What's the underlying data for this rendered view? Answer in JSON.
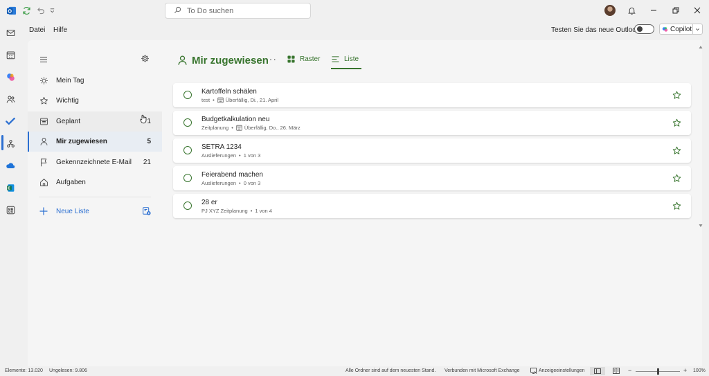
{
  "titlebar": {
    "search_placeholder": "To Do suchen"
  },
  "menubar": {
    "items": [
      "Datei",
      "Hilfe"
    ],
    "outlook_toggle_label": "Testen Sie das neue Outlook",
    "copilot_label": "Copilot"
  },
  "sidebar": {
    "items": [
      {
        "label": "Mein Tag",
        "count": "",
        "icon": "sun-icon"
      },
      {
        "label": "Wichtig",
        "count": "",
        "icon": "star-icon"
      },
      {
        "label": "Geplant",
        "count": "1",
        "icon": "calendar-icon"
      },
      {
        "label": "Mir zugewiesen",
        "count": "5",
        "icon": "person-icon"
      },
      {
        "label": "Gekennzeichnete E-Mail",
        "count": "21",
        "icon": "flag-icon"
      },
      {
        "label": "Aufgaben",
        "count": "",
        "icon": "home-icon"
      }
    ],
    "new_list_label": "Neue Liste"
  },
  "main": {
    "title": "Mir zugewiesen",
    "more": "···",
    "view_grid": "Raster",
    "view_list": "Liste",
    "tasks": [
      {
        "title": "Kartoffeln schälen",
        "list": "test",
        "detail": "Überfällig, Di., 21. April",
        "has_date": true
      },
      {
        "title": "Budgetkalkulation neu",
        "list": "Zeitplanung",
        "detail": "Überfällig, Do., 26. März",
        "has_date": true
      },
      {
        "title": "SETRA 1234",
        "list": "Auslieferungen",
        "detail": "1 von 3",
        "has_date": false
      },
      {
        "title": "Feierabend machen",
        "list": "Auslieferungen",
        "detail": "0 von 3",
        "has_date": false
      },
      {
        "title": "28 er",
        "list": "PJ XYZ Zeitplanung",
        "detail": "1 von 4",
        "has_date": false
      }
    ]
  },
  "statusbar": {
    "items_count": "Elemente: 13.020",
    "unread_count": "Ungelesen: 9.806",
    "folders_status": "Alle Ordner sind auf dem neuesten Stand.",
    "connection": "Verbunden mit Microsoft Exchange",
    "display_settings": "Anzeigeeinstellungen",
    "zoom_minus": "−",
    "zoom_plus": "+",
    "zoom_level": "100%"
  },
  "colors": {
    "accent_green": "#37742d",
    "accent_blue": "#2b6fd1"
  }
}
